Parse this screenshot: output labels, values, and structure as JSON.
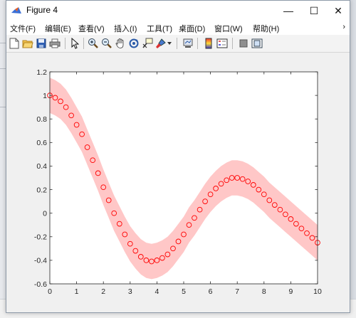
{
  "window": {
    "title": "Figure 4",
    "minimize_symbol": "—",
    "maximize_symbol": "☐",
    "close_symbol": "✕"
  },
  "menu": {
    "items": [
      {
        "label": "文件(F)"
      },
      {
        "label": "编辑(E)"
      },
      {
        "label": "查看(V)"
      },
      {
        "label": "插入(I)"
      },
      {
        "label": "工具(T)"
      },
      {
        "label": "桌面(D)"
      },
      {
        "label": "窗口(W)"
      },
      {
        "label": "帮助(H)"
      }
    ],
    "overflow_symbol": "›"
  },
  "toolbar": {
    "icons": [
      "new-figure-icon",
      "open-file-icon",
      "save-icon",
      "print-icon",
      "pointer-icon",
      "zoom-in-icon",
      "zoom-out-icon",
      "pan-hand-icon",
      "rotate-3d-icon",
      "data-cursor-icon",
      "brush-icon",
      "link-plot-icon",
      "colorbar-icon",
      "legend-icon",
      "hide-plot-tools-icon",
      "show-plot-tools-icon"
    ]
  },
  "colors": {
    "band": "#ffc7c7",
    "marker": "#ff0000",
    "axes_bg": "#ffffff",
    "figure_bg": "#f0f0f0"
  },
  "chart_data": {
    "type": "scatter",
    "title": "",
    "xlabel": "",
    "ylabel": "",
    "xlim": [
      0,
      10
    ],
    "ylim": [
      -0.6,
      1.2
    ],
    "xticks": [
      "0",
      "1",
      "2",
      "3",
      "4",
      "5",
      "6",
      "7",
      "8",
      "9",
      "10"
    ],
    "yticks": [
      "-0.6",
      "-0.4",
      "-0.2",
      "0",
      "0.2",
      "0.4",
      "0.6",
      "0.8",
      "1",
      "1.2"
    ],
    "grid": false,
    "series": [
      {
        "kind": "markers",
        "marker": "circle",
        "x": [
          0.0,
          0.2,
          0.4,
          0.6,
          0.8,
          1.0,
          1.2,
          1.4,
          1.6,
          1.8,
          2.0,
          2.2,
          2.4,
          2.6,
          2.8,
          3.0,
          3.2,
          3.4,
          3.6,
          3.8,
          4.0,
          4.2,
          4.4,
          4.6,
          4.8,
          5.0,
          5.2,
          5.4,
          5.6,
          5.8,
          6.0,
          6.2,
          6.4,
          6.6,
          6.8,
          7.0,
          7.2,
          7.4,
          7.6,
          7.8,
          8.0,
          8.2,
          8.4,
          8.6,
          8.8,
          9.0,
          9.2,
          9.4,
          9.6,
          9.8,
          10.0
        ],
        "y": [
          1.0,
          0.98,
          0.95,
          0.9,
          0.83,
          0.75,
          0.67,
          0.56,
          0.45,
          0.34,
          0.22,
          0.11,
          0.0,
          -0.09,
          -0.18,
          -0.26,
          -0.32,
          -0.37,
          -0.4,
          -0.41,
          -0.4,
          -0.38,
          -0.35,
          -0.3,
          -0.24,
          -0.18,
          -0.1,
          -0.04,
          0.03,
          0.1,
          0.16,
          0.21,
          0.25,
          0.28,
          0.3,
          0.3,
          0.29,
          0.27,
          0.24,
          0.2,
          0.16,
          0.11,
          0.07,
          0.03,
          -0.01,
          -0.05,
          -0.09,
          -0.13,
          -0.17,
          -0.21,
          -0.25
        ]
      },
      {
        "kind": "band",
        "half_width": 0.15,
        "description_of_center": "same as markers"
      }
    ]
  }
}
